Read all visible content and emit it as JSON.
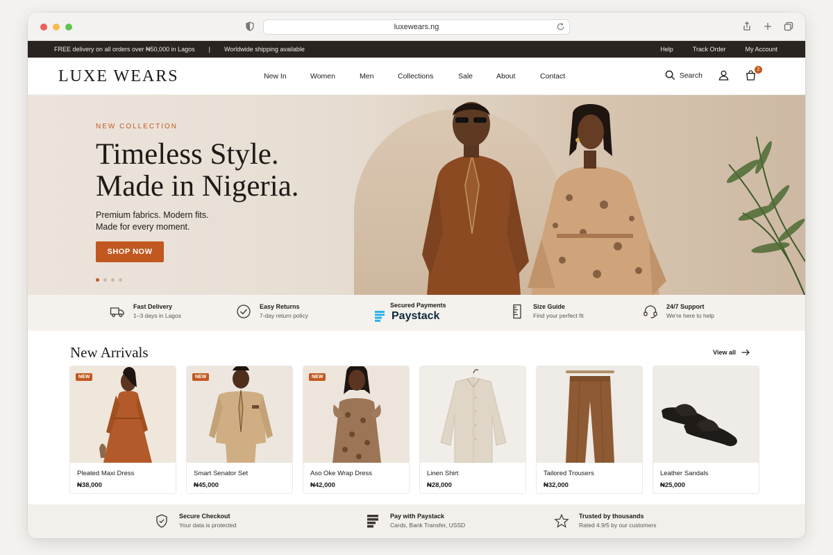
{
  "browser": {
    "url": "luxewears.ng"
  },
  "announcement": {
    "left": [
      "FREE delivery on all orders over ₦50,000 in Lagos",
      "|",
      "Worldwide shipping available"
    ],
    "right": [
      "Help",
      "Track Order",
      "My Account"
    ]
  },
  "header": {
    "logo": "LUXE WEARS",
    "nav": [
      "New In",
      "Women",
      "Men",
      "Collections",
      "Sale",
      "About",
      "Contact"
    ],
    "search_label": "Search",
    "cart_count": "2"
  },
  "hero": {
    "eyebrow": "NEW COLLECTION",
    "headline_line1": "Timeless Style.",
    "headline_line2": "Made in Nigeria.",
    "sub_line1": "Premium fabrics. Modern fits.",
    "sub_line2": "Made for every moment.",
    "cta": "SHOP NOW",
    "slide_count": 4,
    "active_slide": 1
  },
  "features": [
    {
      "icon": "truck-icon",
      "title": "Fast Delivery",
      "sub": "1–3 days in Lagos"
    },
    {
      "icon": "check-circle-icon",
      "title": "Easy Returns",
      "sub": "7-day return policy"
    },
    {
      "icon": "ruler-icon",
      "title": "Size Guide",
      "sub": "Find your perfect fit"
    },
    {
      "icon": "headset-icon",
      "title": "24/7 Support",
      "sub": "We're here to help"
    }
  ],
  "payments": {
    "caption": "Secured Payments",
    "brand": "Paystack"
  },
  "arrivals": {
    "title": "New Arrivals",
    "view_all": "View all",
    "products": [
      {
        "name": "Pleated Maxi Dress",
        "price": "₦38,000",
        "badge": "NEW"
      },
      {
        "name": "Smart Senator Set",
        "price": "₦45,000",
        "badge": "NEW"
      },
      {
        "name": "Aso Oke Wrap Dress",
        "price": "₦42,000",
        "badge": "NEW"
      },
      {
        "name": "Linen Shirt",
        "price": "₦28,000",
        "badge": ""
      },
      {
        "name": "Tailored Trousers",
        "price": "₦32,000",
        "badge": ""
      },
      {
        "name": "Leather Sandals",
        "price": "₦25,000",
        "badge": ""
      }
    ]
  },
  "trust": [
    {
      "icon": "shield-check-icon",
      "title": "Secure Checkout",
      "sub": "Your data is protected"
    },
    {
      "icon": "paystack-icon",
      "title": "Pay with Paystack",
      "sub": "Cards, Bank Transfer, USSD"
    },
    {
      "icon": "star-icon",
      "title": "Trusted by thousands",
      "sub": "Rated 4.9/5 by our customers"
    }
  ],
  "colors": {
    "accent": "#c1581f",
    "topbar": "#2a2420",
    "hero_bg": "#e6ddd2"
  }
}
